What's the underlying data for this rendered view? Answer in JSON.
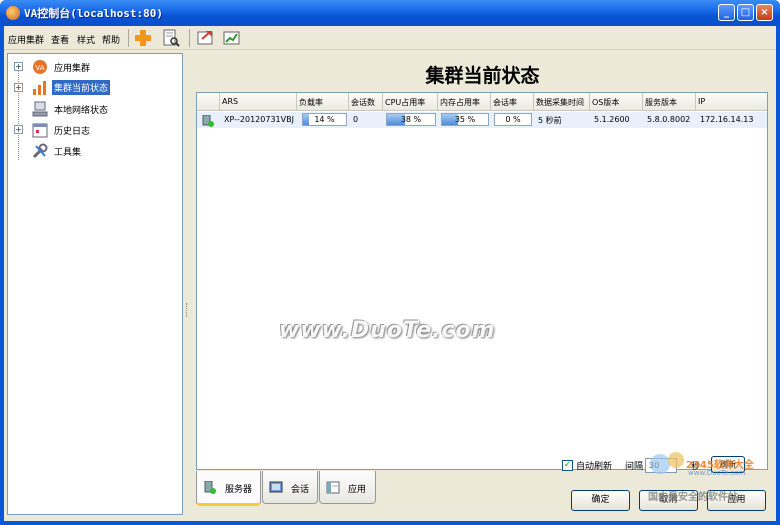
{
  "window": {
    "title": "VA控制台(localhost:80)",
    "minimize_glyph": "_",
    "maximize_glyph": "□",
    "close_glyph": "×"
  },
  "menu": {
    "items": [
      "应用集群",
      "查看",
      "样式",
      "帮助"
    ]
  },
  "toolbar": {
    "icons": [
      "add-icon",
      "search-document-icon",
      "export-icon",
      "chart-icon"
    ]
  },
  "tree": {
    "items": [
      {
        "label": "应用集群",
        "icon": "app-cluster-icon",
        "expander": "+"
      },
      {
        "label": "集群当前状态",
        "icon": "bar-chart-icon",
        "expander": "+",
        "selected": true
      },
      {
        "label": "本地网络状态",
        "icon": "network-icon"
      },
      {
        "label": "历史日志",
        "icon": "calendar-icon",
        "expander": "+"
      },
      {
        "label": "工具集",
        "icon": "tools-icon"
      }
    ]
  },
  "main": {
    "title": "集群当前状态",
    "columns": [
      "",
      "ARS",
      "负载率",
      "会话数",
      "CPU占用率",
      "内存占用率",
      "会话率",
      "数据采集时间",
      "OS版本",
      "服务版本",
      "IP"
    ],
    "rows": [
      {
        "ars": "XP--20120731VBJ",
        "load": {
          "text": "14 %",
          "pct": 14
        },
        "sessions": "0",
        "cpu": {
          "text": "38 %",
          "pct": 38
        },
        "memory": {
          "text": "35 %",
          "pct": 35
        },
        "session_rate": {
          "text": "0 %",
          "pct": 0
        },
        "collect_time": "5 秒前",
        "os_version": "5.1.2600",
        "service_version": "5.8.0.8002",
        "ip": "172.16.14.13"
      }
    ]
  },
  "watermark": "www.DuoTe.com",
  "tabs": [
    {
      "label": "服务器",
      "icon": "server-icon",
      "active": true
    },
    {
      "label": "会话",
      "icon": "session-icon"
    },
    {
      "label": "应用",
      "icon": "application-icon"
    }
  ],
  "refresh": {
    "auto_label": "自动刷新",
    "checked": true,
    "interval_label": "间隔",
    "interval_value": "30",
    "unit": "秒",
    "refresh_button": "刷新"
  },
  "buttons": {
    "ok": "确定",
    "cancel": "取消",
    "apply": "应用"
  },
  "corner_logo": {
    "text": "2345软件大全",
    "subtext": "国内最安全的软件站",
    "url": "www.DuoTe.com"
  }
}
